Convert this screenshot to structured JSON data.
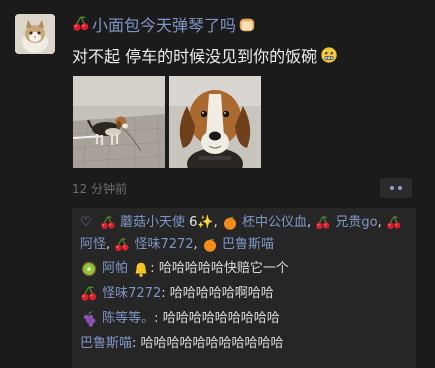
{
  "post": {
    "author": "小面包今天弹琴了吗",
    "text": "对不起 停车的时候没见到你的饭碗",
    "time": "12 分钟前"
  },
  "likes": {
    "names": [
      "蘑菇小天使",
      "柸中公仪血",
      "兄贵go",
      "阿怪",
      "怪味7272",
      "巴鲁斯喵"
    ]
  },
  "comments": [
    {
      "author": "阿帕",
      "text": "哈哈哈哈哈快赔它一个"
    },
    {
      "author": "怪味7272",
      "text": "哈哈哈哈哈啊哈哈"
    },
    {
      "author": "陈等等。",
      "text": "哈哈哈哈哈哈哈哈哈"
    },
    {
      "author": "巴鲁斯喵",
      "text": "哈哈哈哈哈哈哈哈哈哈哈"
    }
  ],
  "icons": {
    "cherry": "cherry-icon",
    "bread": "bread-icon",
    "nervous_face": "grimace-face-icon",
    "heart": "heart-outline-icon",
    "orange": "orange-icon",
    "kiwi": "kiwi-icon",
    "grapes": "grapes-icon",
    "bell": "bell-icon"
  },
  "colors": {
    "background": "#1b1b1b",
    "name_link": "#7f97c6",
    "comment_panel": "#262626"
  }
}
